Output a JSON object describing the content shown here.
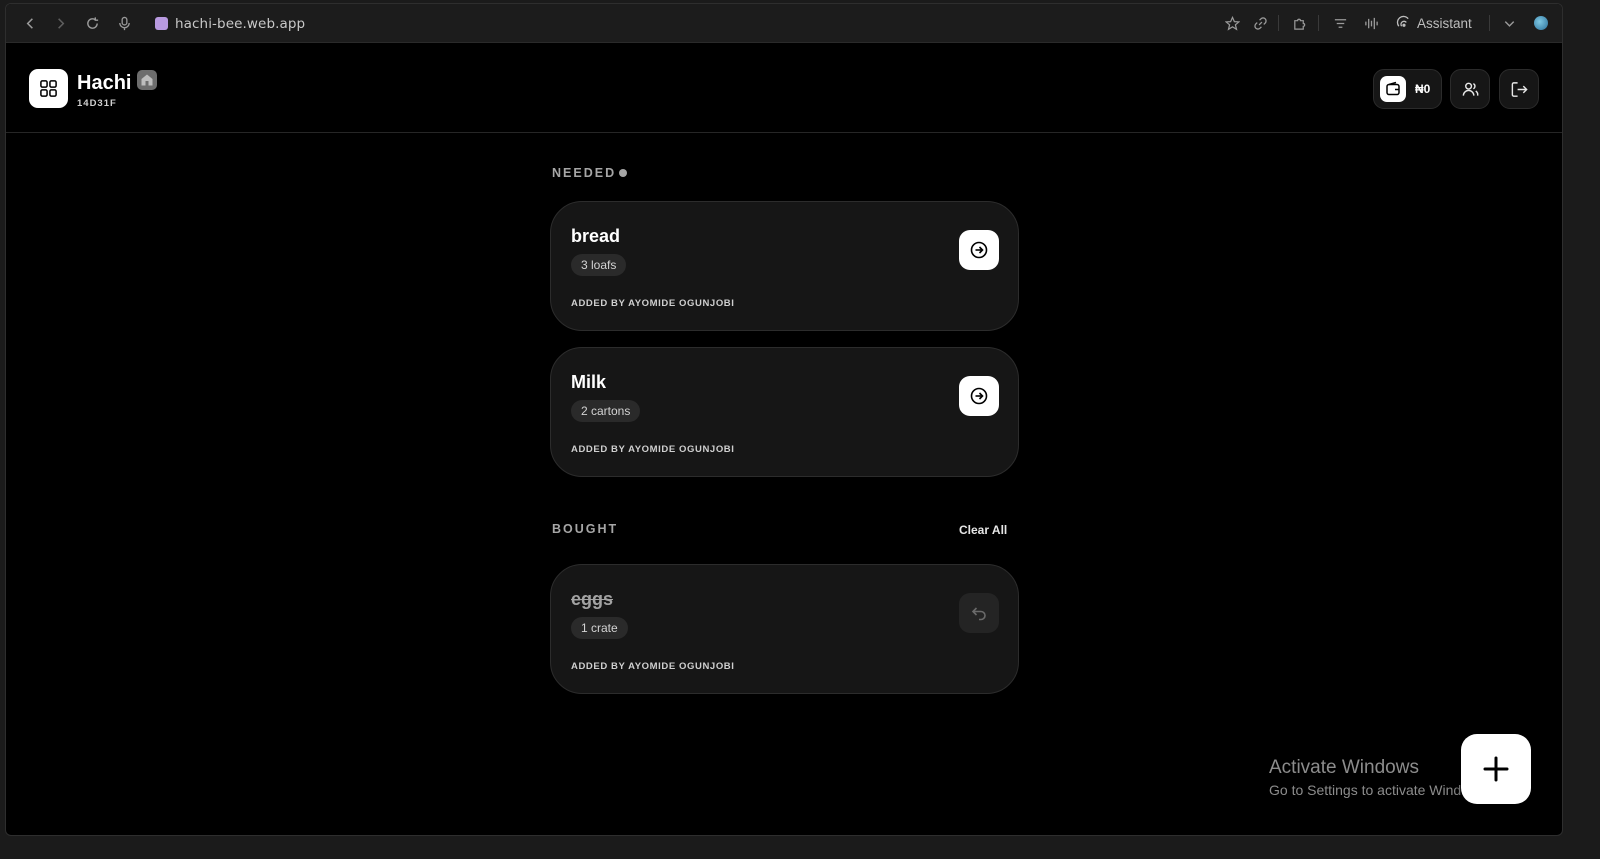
{
  "browser": {
    "url": "hachi-bee.web.app",
    "assistant_label": "Assistant",
    "icons": [
      "back-icon",
      "forward-icon",
      "reload-icon",
      "mic-icon",
      "star-icon",
      "link-icon",
      "extension-icon",
      "menu-icon",
      "audio-icon",
      "assistant-icon",
      "chevron-down-icon"
    ]
  },
  "header": {
    "app_name": "Hachi",
    "code": "14D31F",
    "wallet_amount": "₦0"
  },
  "needed": {
    "label": "NEEDED",
    "items": [
      {
        "name": "bread",
        "quantity": "3 loafs",
        "added_by": "ADDED BY AYOMIDE OGUNJOBI"
      },
      {
        "name": "Milk",
        "quantity": "2 cartons",
        "added_by": "ADDED BY AYOMIDE OGUNJOBI"
      }
    ]
  },
  "bought": {
    "label": "BOUGHT",
    "clear_label": "Clear All",
    "items": [
      {
        "name": "eggs",
        "quantity": "1 crate",
        "added_by": "ADDED BY AYOMIDE OGUNJOBI"
      }
    ]
  },
  "watermark": {
    "title": "Activate Windows",
    "subtitle": "Go to Settings to activate Windows."
  },
  "colors": {
    "background": "#000000",
    "card": "#161616",
    "accent": "#ffffff"
  }
}
